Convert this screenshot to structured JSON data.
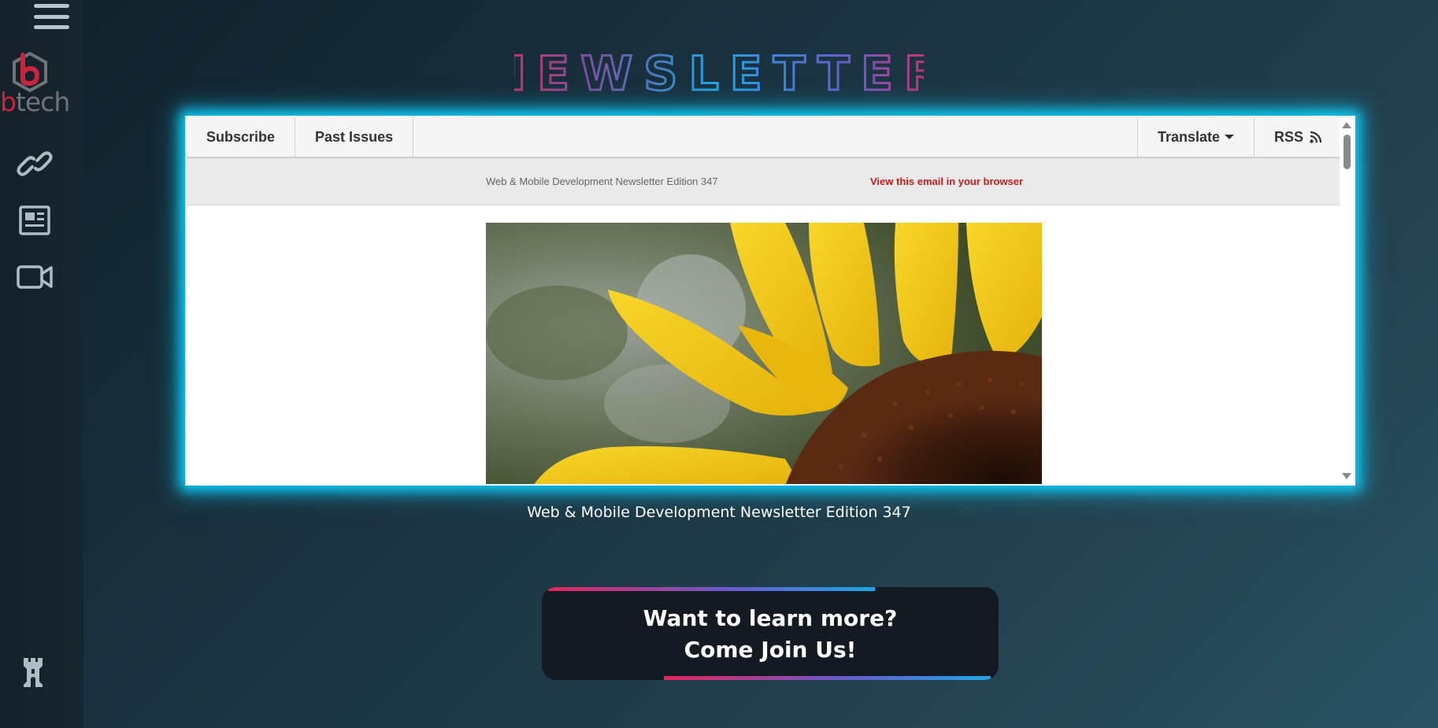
{
  "sidebar": {
    "logo_b": "b",
    "logo_rest": "tech"
  },
  "title": "NEWSLETTER",
  "newsletter": {
    "topbar": {
      "subscribe": "Subscribe",
      "past_issues": "Past Issues",
      "translate": "Translate",
      "rss": "RSS"
    },
    "preheader": {
      "text": "Web & Mobile Development Newsletter Edition 347",
      "link": "View this email in your browser"
    }
  },
  "caption": "Web & Mobile Development Newsletter Edition 347",
  "cta": {
    "line1": "Want to learn more?",
    "line2": "Come Join Us!"
  },
  "colors": {
    "glow": "#0fc7f2",
    "brand_red": "#c8243c",
    "gradient_pink": "#e8245c",
    "gradient_blue": "#1ba6e8",
    "gradient_purple": "#6a5acd"
  }
}
